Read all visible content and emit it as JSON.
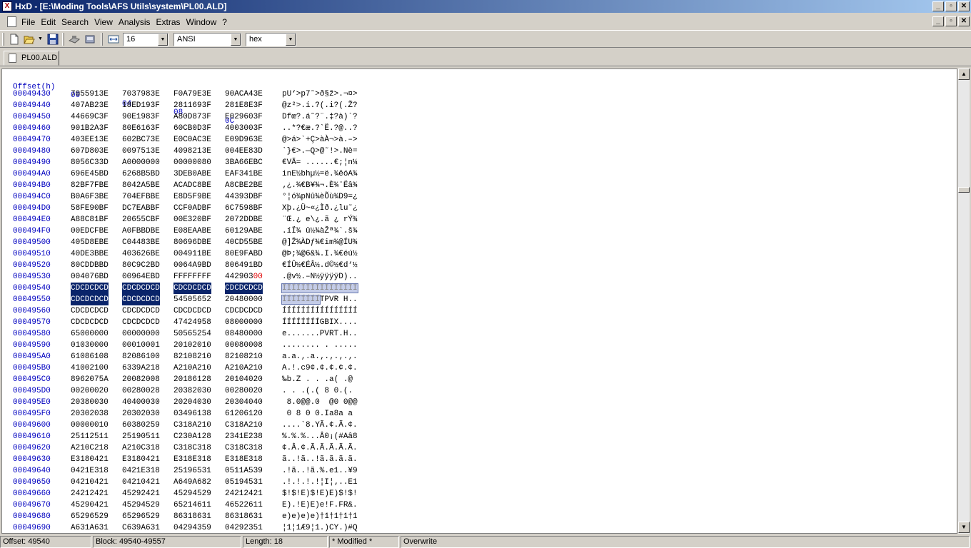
{
  "window": {
    "title": "HxD - [E:\\Moding Tools\\AFS Utils\\system\\PL00.ALD]",
    "app_icon": "hxd-app-icon",
    "buttons": [
      "_",
      "▫",
      "✕"
    ]
  },
  "menu": {
    "items": [
      "File",
      "Edit",
      "Search",
      "View",
      "Analysis",
      "Extras",
      "Window",
      "?"
    ]
  },
  "toolbar": {
    "bytes_per_row": "16",
    "charset": "ANSI",
    "offset_base": "hex"
  },
  "tabs": [
    {
      "label": "PL00.ALD"
    }
  ],
  "editor": {
    "header": {
      "offset_label": "Offset(h)",
      "columns": [
        "00",
        "04",
        "08",
        "0C"
      ]
    },
    "rows": [
      {
        "off": "00049430",
        "g": [
          "7055913E",
          "7037983E",
          "F0A79E3E",
          "90ACA43E"
        ],
        "t": "pU‘>p7˜>ð§ž>.¬¤>"
      },
      {
        "off": "00049440",
        "g": [
          "407AB23E",
          "18ED193F",
          "2811693F",
          "281E8E3F"
        ],
        "t": "@z²>.í.?(.i?(.Ž?"
      },
      {
        "off": "00049450",
        "g": [
          "44669C3F",
          "90E1983F",
          "A80D873F",
          "E029603F"
        ],
        "t": "Dfœ?.á˜?¨.‡?à)`?"
      },
      {
        "off": "00049460",
        "g": [
          "901B2A3F",
          "80E6163F",
          "60CB0D3F",
          "4003003F"
        ],
        "t": "..*?€æ.?`Ë.?@..?"
      },
      {
        "off": "00049470",
        "g": [
          "403EE13E",
          "602BC73E",
          "E0C0AC3E",
          "E09D963E"
        ],
        "t": "@>á>`+Ç>àÀ¬>à.–>"
      },
      {
        "off": "00049480",
        "g": [
          "607D803E",
          "0097513E",
          "4098213E",
          "004EE83D"
        ],
        "t": "`}€>.—Q>@˜!>.Nè="
      },
      {
        "off": "00049490",
        "g": [
          "8056C33D",
          "A0000000",
          "00000080",
          "3BA66EBC"
        ],
        "t": "€VÃ= ......€;¦n¼"
      },
      {
        "off": "000494A0",
        "g": [
          "696E45BD",
          "6268B5BD",
          "3DEB0ABE",
          "EAF341BE"
        ],
        "t": "inE½bhµ½=ë.¾êóA¾"
      },
      {
        "off": "000494B0",
        "g": [
          "82BF7FBE",
          "8042A5BE",
          "ACADC8BE",
          "A8CBE2BE"
        ],
        "t": "‚¿.¾€B¥¾¬.È¾¨Ëâ¾"
      },
      {
        "off": "000494C0",
        "g": [
          "B0A6F3BE",
          "704EFBBE",
          "E8D5F9BE",
          "44393DBF"
        ],
        "t": "°¦ó¾pNû¾èÕù¾D9=¿"
      },
      {
        "off": "000494D0",
        "g": [
          "58FE90BF",
          "DC7EABBF",
          "CCF0ADBF",
          "6C7598BF"
        ],
        "t": "Xþ.¿Ü~«¿Ìð.¿lu˜¿"
      },
      {
        "off": "000494E0",
        "g": [
          "A88C81BF",
          "20655CBF",
          "00E320BF",
          "2072DDBE"
        ],
        "t": "¨Œ.¿ e\\¿.ã ¿ rÝ¾"
      },
      {
        "off": "000494F0",
        "g": [
          "00EDCFBE",
          "A0FBBDBE",
          "E08EAABE",
          "60129ABE"
        ],
        "t": ".íÏ¾ û½¾àŽª¾`.š¾"
      },
      {
        "off": "00049500",
        "g": [
          "405D8EBE",
          "C04483BE",
          "80696DBE",
          "40CD55BE"
        ],
        "t": "@]Ž¾ÀDƒ¾€im¾@ÍU¾"
      },
      {
        "off": "00049510",
        "g": [
          "40DE3BBE",
          "403626BE",
          "004911BE",
          "80E9FABD"
        ],
        "t": "@Þ;¾@6&¾.I.¾€éú½"
      },
      {
        "off": "00049520",
        "g": [
          "80CDDBBD",
          "80C9C2BD",
          "0064A9BD",
          "806491BD"
        ],
        "t": "€ÍÛ½€ÉÂ½.d©½€d‘½"
      },
      {
        "off": "00049530",
        "g": [
          "004076BD",
          "00964EBD",
          "FFFFFFFF",
          "44290300"
        ],
        "t": ".@v½.–N½ÿÿÿÿD)..",
        "red": true
      },
      {
        "off": "00049540",
        "g": [
          "CDCDCDCD",
          "CDCDCDCD",
          "CDCDCDCD",
          "CDCDCDCD"
        ],
        "t": "ÍÍÍÍÍÍÍÍÍÍÍÍÍÍÍÍ",
        "sel": 4
      },
      {
        "off": "00049550",
        "g": [
          "CDCDCDCD",
          "CDCDCDCD",
          "54505652",
          "20480000"
        ],
        "t": "ÍÍÍÍÍÍÍÍTPVR H..",
        "sel": 2
      },
      {
        "off": "00049560",
        "g": [
          "CDCDCDCD",
          "CDCDCDCD",
          "CDCDCDCD",
          "CDCDCDCD"
        ],
        "t": "ÍÍÍÍÍÍÍÍÍÍÍÍÍÍÍÍ"
      },
      {
        "off": "00049570",
        "g": [
          "CDCDCDCD",
          "CDCDCDCD",
          "47424958",
          "08000000"
        ],
        "t": "ÍÍÍÍÍÍÍÍGBIX...."
      },
      {
        "off": "00049580",
        "g": [
          "65000000",
          "00000000",
          "50565254",
          "08480000"
        ],
        "t": "e.......PVRT.H.."
      },
      {
        "off": "00049590",
        "g": [
          "01030000",
          "00010001",
          "20102010",
          "00080008"
        ],
        "t": "........ . ....."
      },
      {
        "off": "000495A0",
        "g": [
          "61086108",
          "82086100",
          "82108210",
          "82108210"
        ],
        "t": "a.a.‚.a.‚.‚.‚.‚."
      },
      {
        "off": "000495B0",
        "g": [
          "41002100",
          "6339A218",
          "A210A210",
          "A210A210"
        ],
        "t": "A.!.c9¢.¢.¢.¢.¢."
      },
      {
        "off": "000495C0",
        "g": [
          "8962075A",
          "20082008",
          "20186128",
          "20104020"
        ],
        "t": "‰b.Z . . .a( .@ "
      },
      {
        "off": "000495D0",
        "g": [
          "00200020",
          "00280028",
          "20382030",
          "00280020"
        ],
        "t": ". . .(.( 8 0.(. "
      },
      {
        "off": "000495E0",
        "g": [
          "20380030",
          "40400030",
          "20204030",
          "20304040"
        ],
        "t": " 8.0@@.0  @0 0@@"
      },
      {
        "off": "000495F0",
        "g": [
          "20302038",
          "20302030",
          "03496138",
          "61206120"
        ],
        "t": " 0 8 0 0.Ia8a a "
      },
      {
        "off": "00049600",
        "g": [
          "00000010",
          "60380259",
          "C318A210",
          "C318A210"
        ],
        "t": "....`8.YÃ.¢.Ã.¢."
      },
      {
        "off": "00049610",
        "g": [
          "25112511",
          "25190511",
          "C230A128",
          "2341E238"
        ],
        "t": "%.%.%...Â0¡(#Aâ8"
      },
      {
        "off": "00049620",
        "g": [
          "A210C218",
          "A210C318",
          "C318C318",
          "C318C318"
        ],
        "t": "¢.Â.¢.Ã.Ã.Ã.Ã.Ã."
      },
      {
        "off": "00049630",
        "g": [
          "E3180421",
          "E3180421",
          "E318E318",
          "E318E318"
        ],
        "t": "ã..!ã..!ã.ã.ã.ã."
      },
      {
        "off": "00049640",
        "g": [
          "0421E318",
          "0421E318",
          "25196531",
          "0511A539"
        ],
        "t": ".!ã..!ã.%.e1..¥9"
      },
      {
        "off": "00049650",
        "g": [
          "04210421",
          "04210421",
          "A649A682",
          "05194531"
        ],
        "t": ".!.!.!.!¦I¦‚..E1"
      },
      {
        "off": "00049660",
        "g": [
          "24212421",
          "45292421",
          "45294529",
          "24212421"
        ],
        "t": "$!$!E)$!E)E)$!$!"
      },
      {
        "off": "00049670",
        "g": [
          "45290421",
          "45294529",
          "65214611",
          "46522611"
        ],
        "t": "E).!E)E)e!F.FR&."
      },
      {
        "off": "00049680",
        "g": [
          "65296529",
          "65296529",
          "86318631",
          "86318631"
        ],
        "t": "e)e)e)e)†1†1†1†1"
      },
      {
        "off": "00049690",
        "g": [
          "A631A631",
          "C639A631",
          "04294359",
          "04292351"
        ],
        "t": "¦1¦1Æ9¦1.)CY.)#Q"
      }
    ]
  },
  "status": {
    "offset": "Offset: 49540",
    "block": "Block: 49540-49557",
    "length": "Length: 18",
    "modified": "* Modified *",
    "mode": "Overwrite"
  }
}
